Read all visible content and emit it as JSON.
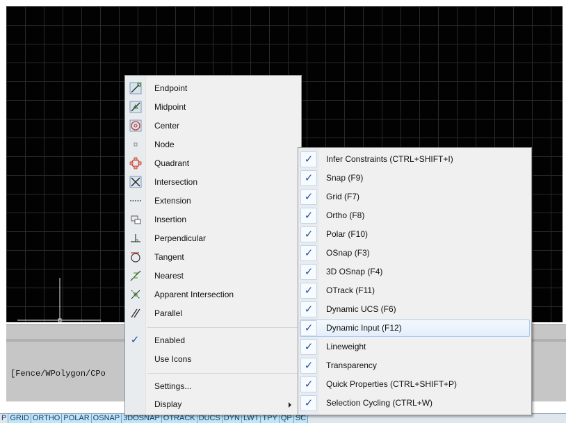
{
  "command_line": {
    "text": "[Fence/WPolygon/CPo"
  },
  "statusbar": {
    "items": [
      "P",
      "GRID",
      "ORTHO",
      "POLAR",
      "OSNAP",
      "3DOSNAP",
      "OTRACK",
      "DUCS",
      "DYN",
      "LWT",
      "TPY",
      "QP",
      "SC"
    ]
  },
  "osnap_menu": {
    "snaps": [
      {
        "label": "Endpoint",
        "icon": "endpoint-icon"
      },
      {
        "label": "Midpoint",
        "icon": "midpoint-icon"
      },
      {
        "label": "Center",
        "icon": "center-icon"
      },
      {
        "label": "Node",
        "icon": "node-icon"
      },
      {
        "label": "Quadrant",
        "icon": "quadrant-icon"
      },
      {
        "label": "Intersection",
        "icon": "intersection-icon"
      },
      {
        "label": "Extension",
        "icon": "extension-icon"
      },
      {
        "label": "Insertion",
        "icon": "insertion-icon"
      },
      {
        "label": "Perpendicular",
        "icon": "perpendicular-icon"
      },
      {
        "label": "Tangent",
        "icon": "tangent-icon"
      },
      {
        "label": "Nearest",
        "icon": "nearest-icon"
      },
      {
        "label": "Apparent Intersection",
        "icon": "apparent-intersection-icon"
      },
      {
        "label": "Parallel",
        "icon": "parallel-icon"
      }
    ],
    "enabled_label": "Enabled",
    "use_icons_label": "Use Icons",
    "settings_label": "Settings...",
    "display_label": "Display"
  },
  "display_submenu": {
    "items": [
      {
        "label": "Infer Constraints (CTRL+SHIFT+I)",
        "checked": true
      },
      {
        "label": "Snap (F9)",
        "checked": true
      },
      {
        "label": "Grid (F7)",
        "checked": true
      },
      {
        "label": "Ortho (F8)",
        "checked": true
      },
      {
        "label": "Polar (F10)",
        "checked": true
      },
      {
        "label": "OSnap (F3)",
        "checked": true
      },
      {
        "label": "3D OSnap (F4)",
        "checked": true
      },
      {
        "label": "OTrack (F11)",
        "checked": true
      },
      {
        "label": "Dynamic UCS (F6)",
        "checked": true
      },
      {
        "label": "Dynamic Input (F12)",
        "checked": true
      },
      {
        "label": "Lineweight",
        "checked": true
      },
      {
        "label": "Transparency",
        "checked": true
      },
      {
        "label": "Quick Properties (CTRL+SHIFT+P)",
        "checked": true
      },
      {
        "label": "Selection Cycling (CTRL+W)",
        "checked": true
      }
    ],
    "highlighted": "Dynamic Input (F12)"
  }
}
